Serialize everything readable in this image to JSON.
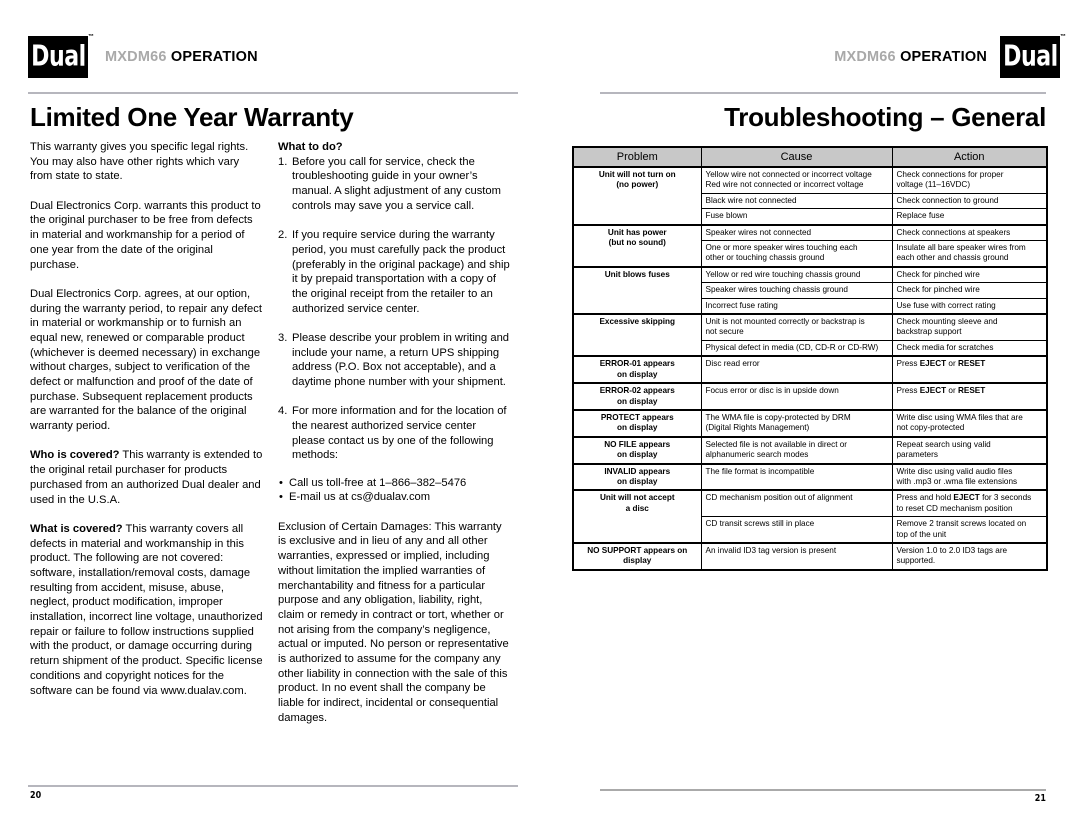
{
  "brand": {
    "logo_text": "Dual",
    "logo_tm": "™"
  },
  "left_page": {
    "header": {
      "model": "MXDM66",
      "word": "OPERATION"
    },
    "title": "Limited One Year Warranty",
    "page_number": "20",
    "column_a": {
      "paragraphs": [
        "This warranty gives you specific legal rights. You may also have other rights which vary from state to state.",
        "Dual Electronics Corp. warrants this product to the original purchaser to be free from defects in material and workmanship for a period of one year from the date of the original purchase.",
        "Dual Electronics Corp. agrees, at our option, during the warranty period, to repair any defect in material or workmanship or to furnish an equal new, renewed or comparable product (whichever is deemed necessary) in exchange without charges, subject to verification of the defect or malfunction and proof of the date of purchase. Subsequent replacement products are warranted for the balance of the original warranty period."
      ],
      "who_is_covered_label": "Who is covered?",
      "who_is_covered_text": " This warranty is extended to the original retail purchaser for products purchased from an authorized Dual dealer and used in the U.S.A.",
      "what_is_covered_label": "What is covered?",
      "what_is_covered_text": " This warranty covers all defects in material and workmanship in this product. The following are not covered: software, installation/removal costs, damage resulting from accident, misuse, abuse, neglect, product modification, improper installation, incorrect line voltage, unauthorized repair or failure to follow instructions supplied with the product, or damage occurring during return shipment of the product. Specific license conditions and copyright notices for the software can be found via www.dualav.com."
    },
    "column_b": {
      "what_to_do_label": "What to do?",
      "steps": [
        {
          "num": "1.",
          "text": "Before you call for service, check the troubleshooting guide in your owner’s manual. A slight adjustment of any custom controls may save you a service call."
        },
        {
          "num": "2.",
          "text": "If you require service during the warranty period, you must carefully pack the product (preferably in the original package) and ship it by prepaid transportation with a copy of the original receipt from the retailer to an authorized service center."
        },
        {
          "num": "3.",
          "text": "Please describe your problem in writing and include your name, a return UPS shipping address (P.O. Box not acceptable), and a daytime phone number with your shipment."
        },
        {
          "num": "4.",
          "text": "For more information and for the location of the nearest authorized service center please contact us by one of the following methods:"
        }
      ],
      "contact_methods": [
        "Call us toll-free at 1–866–382–5476",
        "E-mail us at cs@dualav.com"
      ],
      "exclusion_paragraph": "Exclusion of Certain Damages: This warranty is exclusive and in lieu of any and all other warranties, expressed or implied, including without limitation the implied warranties of merchantability and fitness for a particular purpose and any obligation, liability, right, claim or remedy in contract or tort, whether or not arising from the company’s negligence, actual or imputed. No person or representative is authorized to assume for the company any other liability in connection with the sale of this product. In no event shall the company be liable for indirect, incidental or consequential damages."
    }
  },
  "right_page": {
    "header": {
      "model": "MXDM66",
      "word": "OPERATION"
    },
    "title": "Troubleshooting – General",
    "page_number": "21",
    "table": {
      "headers": [
        "Problem",
        "Cause",
        "Action"
      ],
      "groups": [
        {
          "problem": "Unit will not turn on\n(no power)",
          "rows": [
            {
              "cause": "Yellow wire not connected or incorrect voltage\nRed wire not connected or incorrect voltage",
              "action": "Check connections for proper\nvoltage (11–16VDC)"
            },
            {
              "cause": "Black wire not connected",
              "action": "Check connection to ground"
            },
            {
              "cause": "Fuse blown",
              "action": "Replace fuse"
            }
          ]
        },
        {
          "problem": "Unit has power\n(but no sound)",
          "rows": [
            {
              "cause": "Speaker wires not connected",
              "action": "Check connections at speakers"
            },
            {
              "cause": "One or more speaker wires touching each\nother or touching chassis ground",
              "action": "Insulate all bare speaker wires from\neach other and chassis ground"
            }
          ]
        },
        {
          "problem": "Unit blows fuses",
          "rows": [
            {
              "cause": "Yellow or red wire touching chassis ground",
              "action": "Check for pinched wire"
            },
            {
              "cause": "Speaker wires touching chassis ground",
              "action": "Check for pinched wire"
            },
            {
              "cause": "Incorrect fuse rating",
              "action": "Use fuse with correct rating"
            }
          ]
        },
        {
          "problem": "Excessive skipping",
          "rows": [
            {
              "cause": "Unit is not mounted correctly or backstrap is\nnot secure",
              "action": "Check mounting sleeve and\nbackstrap support"
            },
            {
              "cause": "Physical defect in media (CD, CD-R or CD-RW)",
              "action": "Check media for scratches"
            }
          ]
        },
        {
          "problem": "ERROR-01 appears\non display",
          "rows": [
            {
              "cause": "Disc read error",
              "action_prefix": "Press ",
              "action_kbd1": "EJECT",
              "action_mid": " or ",
              "action_kbd2": "RESET",
              "action": "Press EJECT or RESET"
            }
          ]
        },
        {
          "problem": "ERROR-02 appears\non display",
          "rows": [
            {
              "cause": "Focus error or disc is in upside down",
              "action": "Press EJECT or RESET"
            }
          ]
        },
        {
          "problem": "PROTECT appears\non display",
          "rows": [
            {
              "cause": "The WMA file is copy-protected by DRM\n(Digital Rights Management)",
              "action": "Write disc using WMA files that are\nnot copy-protected"
            }
          ]
        },
        {
          "problem": "NO FILE appears\non display",
          "rows": [
            {
              "cause": "Selected file is not available in direct or\nalphanumeric search modes",
              "action": "Repeat search using valid\nparameters"
            }
          ]
        },
        {
          "problem": "INVALID appears\non display",
          "rows": [
            {
              "cause": "The file format is incompatible",
              "action": "Write disc using valid audio files\nwith .mp3 or .wma file extensions"
            }
          ]
        },
        {
          "problem": "Unit will not accept\na disc",
          "rows": [
            {
              "cause": "CD mechanism position out of alignment",
              "action": "Press and hold EJECT for 3 seconds\nto reset CD mechanism position"
            },
            {
              "cause": "CD transit screws still in place",
              "action": "Remove 2 transit screws located on\ntop of the unit"
            }
          ]
        },
        {
          "problem": "NO SUPPORT appears on\ndisplay",
          "rows": [
            {
              "cause": "An invalid ID3 tag version is present",
              "action": "Version 1.0 to 2.0 ID3 tags are\nsupported."
            }
          ]
        }
      ]
    }
  }
}
